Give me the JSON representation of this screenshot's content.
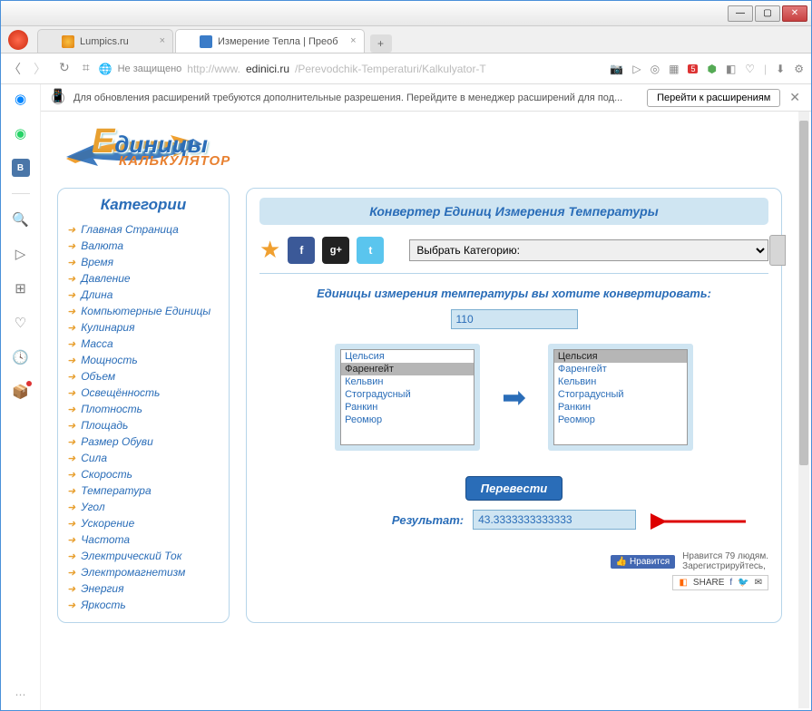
{
  "window": {
    "min": "—",
    "max": "▢",
    "close": "✕"
  },
  "tabs": {
    "tab1": "Lumpics.ru",
    "tab2": "Измерение Тепла | Преоб",
    "add": "+"
  },
  "address": {
    "secure_text": "Не защищено",
    "url_host": "http://www.",
    "url_path": "edinici.ru",
    "url_rest": "/Perevodchik-Temperaturi/Kalkulyator-T",
    "badge": "5"
  },
  "notif": {
    "text": "Для обновления расширений требуются дополнительные разрешения. Перейдите в менеджер расширений для под...",
    "button": "Перейти к расширениям",
    "close": "✕",
    "info": "i"
  },
  "logo": {
    "line1_cap": "Е",
    "line1_rest": "диницы",
    "line2": "КАЛЬКУЛЯТОР"
  },
  "sidebar": {
    "title": "Категории",
    "items": [
      "Главная Страница",
      "Валюта",
      "Время",
      "Давление",
      "Длина",
      "Компьютерные Единицы",
      "Кулинария",
      "Масса",
      "Мощность",
      "Объем",
      "Освещённость",
      "Плотность",
      "Площадь",
      "Размер Обуви",
      "Сила",
      "Скорость",
      "Температура",
      "Угол",
      "Ускорение",
      "Частота",
      "Электрический Ток",
      "Электромагнетизм",
      "Энергия",
      "Яркость"
    ]
  },
  "panel": {
    "title": "Конвертер Единиц Измерения Температуры",
    "category_placeholder": "Выбрать Категорию:",
    "prompt": "Единицы измерения температуры вы хотите конвертировать:",
    "input_value": "110",
    "units": [
      "Цельсия",
      "Фаренгейт",
      "Кельвин",
      "Стоградусный",
      "Ранкин",
      "Реомюр"
    ],
    "from_selected": "Фаренгейт",
    "to_selected": "Цельсия",
    "convert_btn": "Перевести",
    "result_label": "Результат:",
    "result_value": "43.3333333333333"
  },
  "social": {
    "fb": "f",
    "gp": "g+",
    "tw": "t",
    "like_btn": "Нравится",
    "like_text1": "Нравится 79 людям.",
    "like_text2": "Зарегистрируйтесь,",
    "share": "SHARE"
  }
}
